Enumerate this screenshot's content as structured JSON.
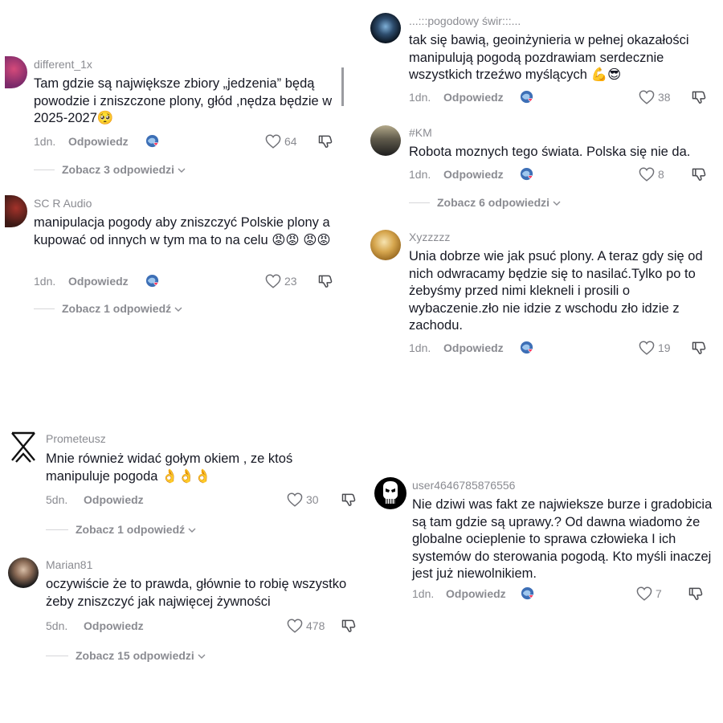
{
  "comments": [
    {
      "username": "different_1x",
      "text": "Tam gdzie są największe zbiory „jedzenia” będą powodzie i zniszczone plony, głód ,nędza będzie w 2025-2027🥺",
      "time": "1dn.",
      "reply_label": "Odpowiedz",
      "likes": "64",
      "view_replies": "Zobacz 3 odpowiedzi"
    },
    {
      "username": "SC R Audio",
      "text": "manipulacja pogody aby zniszczyć Polskie plony a kupować od innych w tym ma to na celu 😡😡 😡😡",
      "time": "1dn.",
      "reply_label": "Odpowiedz",
      "likes": "23",
      "view_replies": "Zobacz 1 odpowiedź"
    },
    {
      "username": "...:::pogodowy świr:::...",
      "text": "tak się bawią, geoinżynieria w pełnej okazałości manipulują pogodą pozdrawiam serdecznie wszystkich trzeźwo myślących 💪😎",
      "time": "1dn.",
      "reply_label": "Odpowiedz",
      "likes": "38"
    },
    {
      "username": "#KM",
      "text": "Robota moznych tego świata. Polska się nie da.",
      "time": "1dn.",
      "reply_label": "Odpowiedz",
      "likes": "8",
      "view_replies": "Zobacz 6 odpowiedzi"
    },
    {
      "username": "Xyzzzzz",
      "text": "Unia dobrze wie jak psuć plony. A teraz gdy się od nich odwracamy będzie się to nasilać.Tylko po to żebyśmy przed nimi klekneli i prosili o wybaczenie.zło nie idzie z wschodu zło idzie z zachodu.",
      "time": "1dn.",
      "reply_label": "Odpowiedz",
      "likes": "19"
    },
    {
      "username": "Prometeusz",
      "text": "Mnie również widać gołym okiem , ze ktoś manipuluje pogoda 👌👌👌",
      "time": "5dn.",
      "reply_label": "Odpowiedz",
      "likes": "30",
      "view_replies": "Zobacz 1 odpowiedź"
    },
    {
      "username": "Marian81",
      "text": "oczywiście że to prawda, głównie to robię wszystko żeby zniszczyć jak najwięcej żywności",
      "time": "5dn.",
      "reply_label": "Odpowiedz",
      "likes": "478",
      "view_replies": "Zobacz 15 odpowiedzi"
    },
    {
      "username": "user4646785876556",
      "text": "Nie dziwi was fakt ze najwieksze burze i gradobicia są tam gdzie są uprawy.? Od dawna wiadomo że globalne ocieplenie to sprawa człowieka I ich systemów do sterowania pogodą. Kto myśli inaczej jest już niewolnikiem.",
      "time": "1dn.",
      "reply_label": "Odpowiedz",
      "likes": "7"
    }
  ],
  "icons": {
    "like": "heart-outline-icon",
    "dislike": "thumbs-down-icon",
    "creator_liked": "creator-liked-badge-icon",
    "expand": "chevron-down-icon"
  },
  "colors": {
    "text": "#161823",
    "muted": "#8a8b91",
    "heart_badge": "#fe2c55"
  }
}
